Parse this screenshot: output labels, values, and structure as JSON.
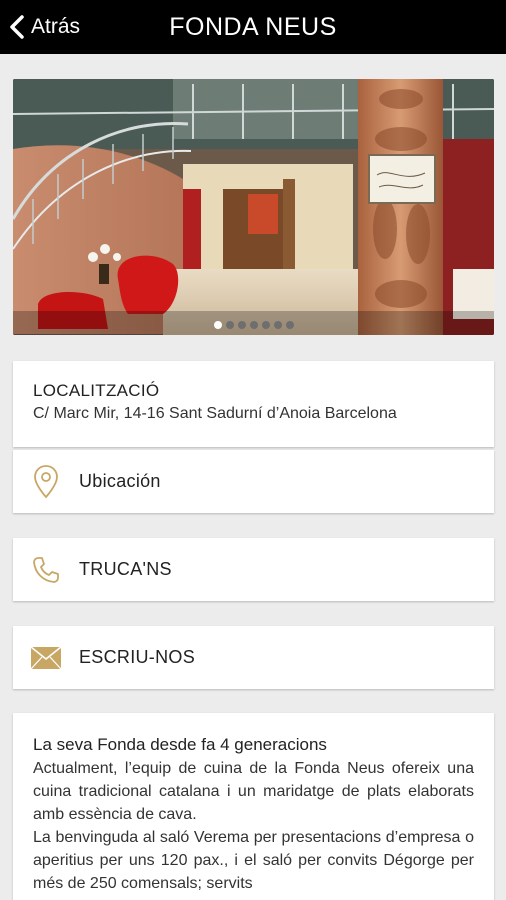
{
  "header": {
    "back_label": "Atrás",
    "title": "FONDA NEUS"
  },
  "gallery": {
    "image_sign_text": "Banquets Casa Neus",
    "slides": 7,
    "active_slide": 1
  },
  "location": {
    "heading": "LOCALITZACIÓ",
    "address": "C/ Marc Mir, 14-16 Sant Sadurní d’Anoia Barcelona"
  },
  "actions": {
    "map_label": "Ubicación",
    "call_label": "TRUCA'NS",
    "email_label": "ESCRIU-NOS"
  },
  "description": {
    "heading": "La seva Fonda desde fa 4 generacions",
    "paragraph1": "Actualment, l’equip de cuina de la Fonda Neus ofereix una cuina tradicional catalana i un maridatge de plats elaborats amb essència de cava.",
    "paragraph2": "La benvinguda al saló Verema per presentacions d’empresa o aperitius per uns 120 pax., i el saló per convits Dégorge per més de 250 comensals; servits"
  },
  "colors": {
    "accent_gold": "#c8a765",
    "topbar": "#000000",
    "background": "#ececec"
  }
}
